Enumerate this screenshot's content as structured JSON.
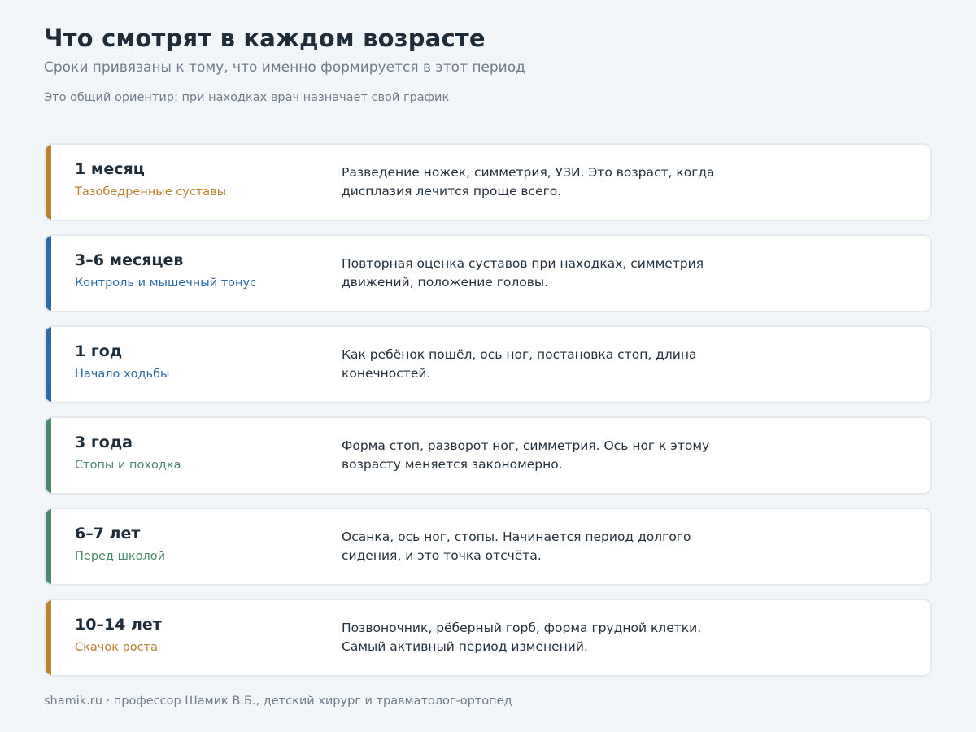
{
  "header": {
    "title": "Что смотрят в каждом возрасте",
    "subtitle": "Сроки привязаны к тому, что именно формируется в этот период",
    "note": "Это общий ориентир: при находках врач назначает свой график"
  },
  "cards": [
    {
      "age": "1 месяц",
      "topic": "Тазобедренные суставы",
      "desc": "Разведение ножек, симметрия, УЗИ. Это возраст, когда дисплазия лечится проще всего.",
      "color": "#b7832f"
    },
    {
      "age": "3–6 месяцев",
      "topic": "Контроль и мышечный тонус",
      "desc": "Повторная оценка суставов при находках, симметрия движений, положение головы.",
      "color": "#2f6aa8"
    },
    {
      "age": "1 год",
      "topic": "Начало ходьбы",
      "desc": "Как ребёнок пошёл, ось ног, постановка стоп, длина конечностей.",
      "color": "#2f6aa8"
    },
    {
      "age": "3 года",
      "topic": "Стопы и походка",
      "desc": "Форма стоп, разворот ног, симметрия. Ось ног к этому возрасту меняется закономерно.",
      "color": "#4a8a6a"
    },
    {
      "age": "6–7 лет",
      "topic": "Перед школой",
      "desc": "Осанка, ось ног, стопы. Начинается период долгого сидения, и это точка отсчёта.",
      "color": "#4a8a6a"
    },
    {
      "age": "10–14 лет",
      "topic": "Скачок роста",
      "desc": "Позвоночник, рёберный горб, форма грудной клетки. Самый активный период изменений.",
      "color": "#b7832f"
    }
  ],
  "footer": {
    "text": "shamik.ru · профессор Шамик В.Б., детский хирург и травматолог-ортопед"
  }
}
